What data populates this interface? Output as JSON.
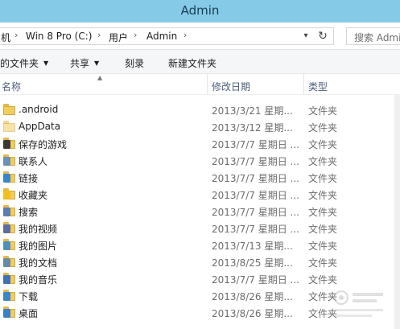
{
  "window": {
    "title": "Admin"
  },
  "address": {
    "crumbs": [
      "机",
      "Win 8 Pro (C:)",
      "用户",
      "Admin"
    ],
    "search_placeholder": "搜索 Admin"
  },
  "commands": {
    "include_in_library": "的文件夹",
    "share": "共享",
    "burn": "刻录",
    "new_folder": "新建文件夹"
  },
  "columns": {
    "name": "名称",
    "date_modified": "修改日期",
    "type": "类型"
  },
  "files": [
    {
      "name": ".android",
      "date": "2013/3/21 星期...",
      "type": "文件夹",
      "icon": "folder-icon"
    },
    {
      "name": "AppData",
      "date": "2013/3/12 星期...",
      "type": "文件夹",
      "icon": "hidden-folder-icon"
    },
    {
      "name": "保存的游戏",
      "date": "2013/7/7 星期日 ...",
      "type": "文件夹",
      "icon": "saved-games-folder-icon"
    },
    {
      "name": "联系人",
      "date": "2013/7/7 星期日 ...",
      "type": "文件夹",
      "icon": "contacts-folder-icon"
    },
    {
      "name": "链接",
      "date": "2013/7/7 星期日 ...",
      "type": "文件夹",
      "icon": "links-folder-icon"
    },
    {
      "name": "收藏夹",
      "date": "2013/7/7 星期日 ...",
      "type": "文件夹",
      "icon": "favorites-folder-icon"
    },
    {
      "name": "搜索",
      "date": "2013/7/7 星期日 ...",
      "type": "文件夹",
      "icon": "searches-folder-icon"
    },
    {
      "name": "我的视频",
      "date": "2013/7/7 星期日 ...",
      "type": "文件夹",
      "icon": "videos-folder-icon"
    },
    {
      "name": "我的图片",
      "date": "2013/7/13 星期...",
      "type": "文件夹",
      "icon": "pictures-folder-icon"
    },
    {
      "name": "我的文档",
      "date": "2013/8/25 星期...",
      "type": "文件夹",
      "icon": "documents-folder-icon"
    },
    {
      "name": "我的音乐",
      "date": "2013/7/7 星期日 ...",
      "type": "文件夹",
      "icon": "music-folder-icon"
    },
    {
      "name": "下载",
      "date": "2013/8/26 星期...",
      "type": "文件夹",
      "icon": "downloads-folder-icon"
    },
    {
      "name": "桌面",
      "date": "2013/8/26 星期...",
      "type": "文件夹",
      "icon": "desktop-folder-icon"
    }
  ],
  "colors": {
    "titlebar": "#85cbe8",
    "folder": "#f2cd5c",
    "badges": [
      "",
      "",
      "#3a3a3a",
      "#6b8fb5",
      "#3a86c8",
      "#f0c020",
      "#5a7fb0",
      "#5a6fa0",
      "#4f8fc0",
      "#6a8aa8",
      "#4070b8",
      "#3a86c8",
      "#3a7fc8"
    ]
  }
}
